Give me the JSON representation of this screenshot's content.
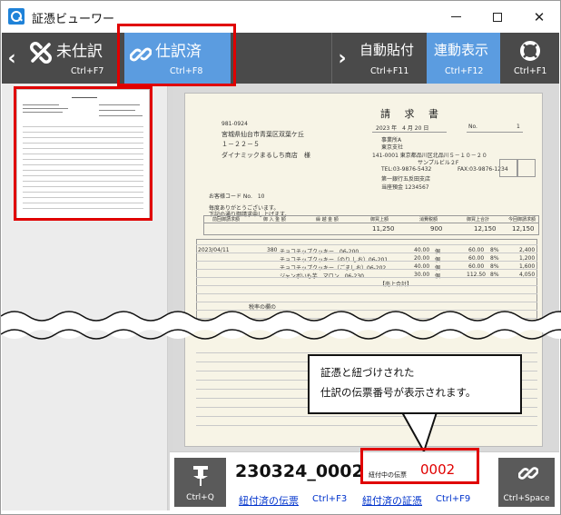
{
  "window": {
    "title": "証憑ビューワー"
  },
  "toolbar": {
    "unjournal": {
      "label": "未仕訳",
      "shortcut": "Ctrl+F7"
    },
    "journaled": {
      "label": "仕訳済",
      "shortcut": "Ctrl+F8"
    },
    "auto_attach": {
      "label": "自動貼付",
      "shortcut": "Ctrl+F11"
    },
    "linked_display": {
      "label": "連動表示",
      "shortcut": "Ctrl+F12"
    },
    "help": {
      "shortcut": "Ctrl+F1"
    }
  },
  "invoice": {
    "title": "請 求 書",
    "date": "2023 年　4 月 20 日",
    "no_label": "No.",
    "no": "1",
    "postal": "981-0924",
    "address_line1": "宮城県仙台市青葉区双葉ケ丘",
    "address_line2": "１－２２－５",
    "customer": "ダイナミックまるしち商店　様",
    "sender_dept1": "事業所A",
    "sender_dept2": "東京支社",
    "sender_address": "141-0001 東京都品川区北品川５－１０－２０",
    "sender_building": "サンプルビル２F",
    "sender_tel": "TEL:03-9876-5432",
    "sender_fax": "FAX:03-9876-1234",
    "sender_bank": "第一銀行五反田支店",
    "sender_account": "当座預金 1234567",
    "customer_code": "お客様コード No.　10",
    "greeting1": "毎度ありがとうございます。",
    "greeting2": "下記の通り御請求申し上げます。",
    "prev_balance_label": "前回御請求額",
    "payment_label": "御 入 金 額",
    "carryover_label": "繰 越 金 額",
    "sales_label": "御買上額",
    "tax_label": "消費税額",
    "total_sales_label": "御買上合計",
    "this_invoice_label": "今回御請求額",
    "sales_amount": "11,250",
    "tax_amount": "900",
    "total_amount": "12,150",
    "this_invoice_amount": "12,150",
    "row_date": "2023/04/11",
    "row_slip": "380",
    "items": [
      {
        "name": "チョコチップクッキー　06-200",
        "qty": "40.00",
        "unit": "個",
        "price": "60.00",
        "tax": "8%",
        "amount": "2,400"
      },
      {
        "name": "チョコチップクッキー（のり しお）06-201",
        "qty": "20.00",
        "unit": "個",
        "price": "60.00",
        "tax": "8%",
        "amount": "1,200"
      },
      {
        "name": "チョコチップクッキー（ごましお）06-202",
        "qty": "40.00",
        "unit": "個",
        "price": "60.00",
        "tax": "8%",
        "amount": "1,600"
      },
      {
        "name": "ジャンボいも芋　マロン　06-230",
        "qty": "30.00",
        "unit": "個",
        "price": "112.50",
        "tax": "8%",
        "amount": "4,050"
      }
    ],
    "subtotal_label": "【売上合計】",
    "note": "税率の欄の"
  },
  "callout": {
    "line1": "証憑と紐づけされた",
    "line2": "仕訳の伝票番号が表示されます。"
  },
  "bottom": {
    "pin_shortcut": "Ctrl+Q",
    "voucher_number": "230324_0002",
    "linking_label": "紐付中の伝票",
    "linking_value": "0002",
    "linked_slip_link": "紐付済の伝票",
    "linked_slip_shortcut": "Ctrl+F3",
    "linked_evidence_link": "紐付済の証憑",
    "linked_evidence_shortcut": "Ctrl+F9",
    "link_shortcut": "Ctrl+Space"
  }
}
